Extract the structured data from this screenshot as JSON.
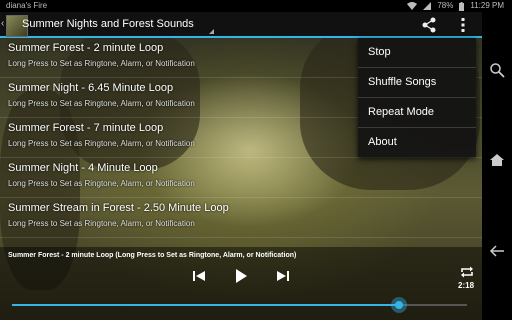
{
  "status_bar": {
    "carrier": "diana's Fire",
    "battery": "78%",
    "time": "11:29 PM"
  },
  "action_bar": {
    "title": "Summer Nights and Forest Sounds"
  },
  "playlist": [
    {
      "title": "Summer Forest - 2 minute Loop",
      "subtitle": "Long Press to Set as Ringtone, Alarm, or Notification"
    },
    {
      "title": "Summer Night - 6.45 Minute Loop",
      "subtitle": "Long Press to Set as Ringtone, Alarm, or Notification"
    },
    {
      "title": "Summer Forest - 7 minute Loop",
      "subtitle": "Long Press to Set as Ringtone, Alarm, or Notification"
    },
    {
      "title": "Summer Night - 4 Minute Loop",
      "subtitle": "Long Press to Set as Ringtone, Alarm, or Notification"
    },
    {
      "title": "Summer Stream in Forest - 2.50 Minute Loop",
      "subtitle": "Long Press to Set as Ringtone, Alarm, or Notification"
    }
  ],
  "overflow_menu": [
    "Stop",
    "Shuffle Songs",
    "Repeat Mode",
    "About"
  ],
  "player": {
    "now_playing": "Summer Forest - 2 minute Loop (Long Press to Set as Ringtone, Alarm, or Notification)",
    "time": "2:18",
    "progress": 0.85
  },
  "icons": {
    "share": "share-icon",
    "overflow": "overflow-menu-icon",
    "prev": "skip-previous-icon",
    "play": "play-icon",
    "next": "skip-next-icon",
    "repeat": "repeat-icon",
    "search": "search-icon",
    "home": "home-icon",
    "back": "back-icon"
  },
  "colors": {
    "accent": "#33b5e5"
  }
}
